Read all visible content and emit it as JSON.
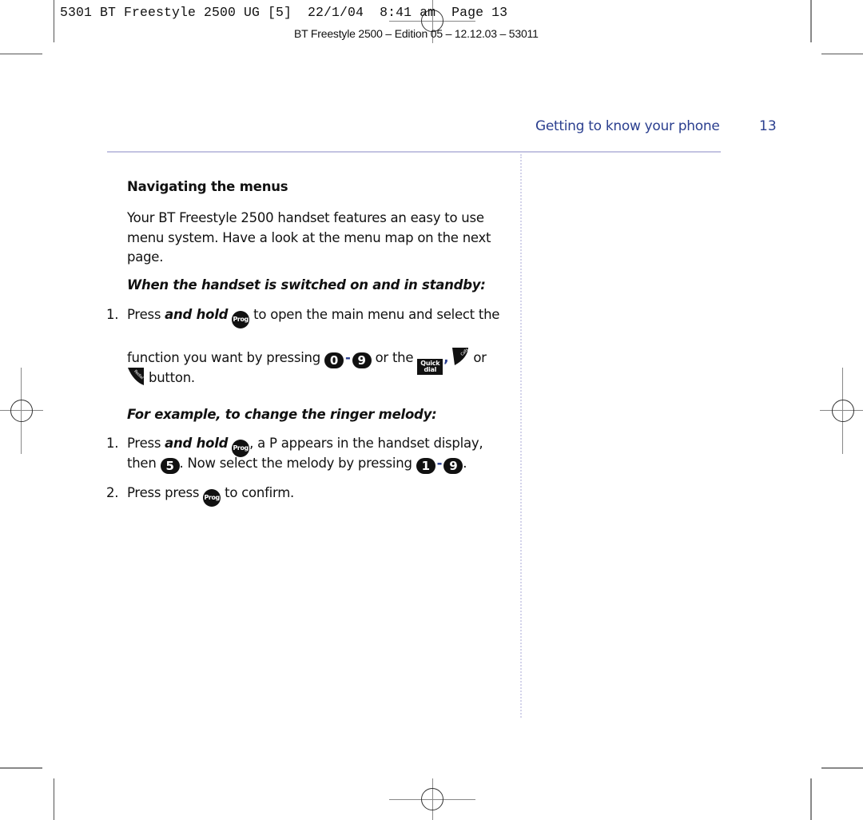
{
  "slug": {
    "text": "5301 BT Freestyle 2500 UG [5]  22/1/04  8:41 am  Page 13",
    "edition": "BT Freestyle 2500 – Edition 05 – 12.12.03 – 53011"
  },
  "running_header": {
    "section": "Getting to know your phone",
    "page_number": "13"
  },
  "content": {
    "heading": "Navigating the menus",
    "intro": "Your BT Freestyle 2500 handset features an easy to use menu system. Have a look at the menu map on the next page.",
    "standby_heading": "When the handset is switched on and in standby:",
    "standby_steps": [
      {
        "number": "1.",
        "line1_pre": "Press ",
        "line1_em": "and hold",
        "line1_post": " to open the main menu and select the",
        "line2_pre": "function you want by pressing ",
        "line2_mid": " or the ",
        "line2_sep": ",",
        "line2_post": " or",
        "line3_post": " button."
      }
    ],
    "example_heading": "For example, to change the ringer melody:",
    "example_steps": [
      {
        "number": "1.",
        "line1_pre": "Press ",
        "line1_em": "and hold",
        "line1_mid": ", a ",
        "line1_glyph": "P",
        "line1_post": " appears in the handset display,",
        "line2_pre": "then ",
        "line2_mid": ". Now select the melody by pressing ",
        "line2_post": "."
      },
      {
        "number": "2.",
        "pre": "Press press ",
        "post": " to confirm."
      }
    ]
  },
  "icons": {
    "prog": "Prog",
    "quick_top": "Quick",
    "quick_bottom": "dial",
    "calls": "Calls",
    "redial": "Redial",
    "range_dash": "-",
    "key_0": "0",
    "key_1": "1",
    "key_5": "5",
    "key_9": "9"
  },
  "colors": {
    "accent_blue": "#2b3f8f",
    "rule": "#c3c3e2"
  }
}
